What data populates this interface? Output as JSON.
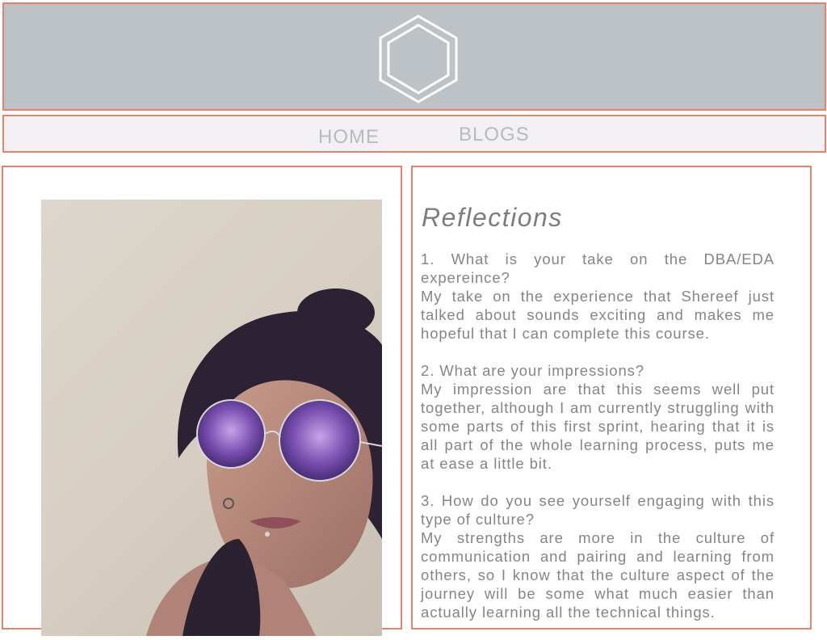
{
  "header": {
    "logo_icon": "hexagon-outline-icon",
    "background_color": "#bcc2c5",
    "border_color": "#e8806c"
  },
  "nav": {
    "items": [
      {
        "label": "HOME"
      },
      {
        "label": "BLOGS"
      }
    ]
  },
  "left_panel": {
    "photo_icon": "portrait-photo"
  },
  "reflections": {
    "title": "Reflections",
    "sections": [
      {
        "question": "1. What is your take on the DBA/EDA expereince?",
        "answer": "My take on the experience that Shereef just talked about sounds exciting and makes me hopeful that I can complete this course."
      },
      {
        "question": "2. What are your impressions?",
        "answer": "My impression are that this seems well put together, although I am currently struggling with some parts of this first sprint, hearing that it is all part of the whole learning process, puts me at ease a little bit."
      },
      {
        "question": "3. How do you see yourself engaging with this type of culture?",
        "answer": "My strengths are more in the culture of communication and pairing and learning from others, so I know that the culture aspect of the journey will be some what much easier than actually learning all the technical things."
      }
    ]
  }
}
